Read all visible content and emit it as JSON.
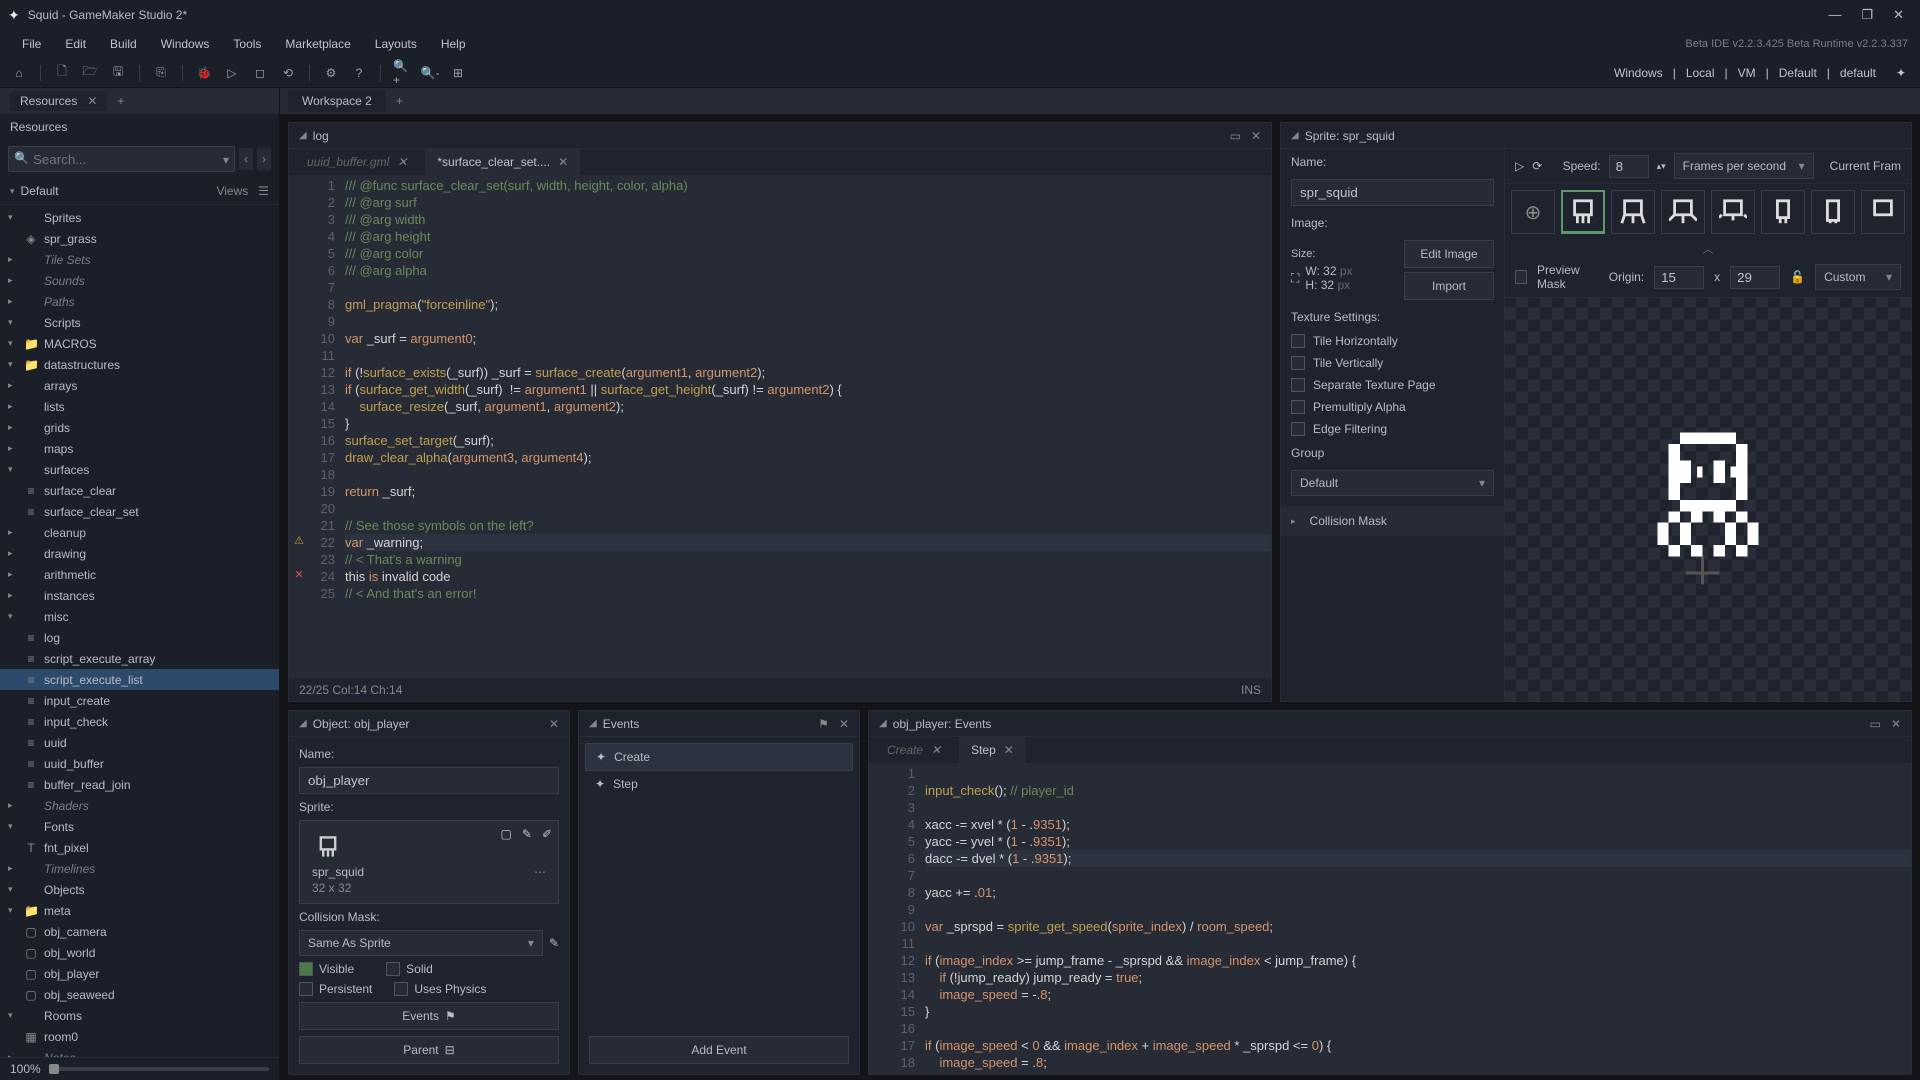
{
  "title": "Squid - GameMaker Studio 2*",
  "menu": [
    "File",
    "Edit",
    "Build",
    "Windows",
    "Tools",
    "Marketplace",
    "Layouts",
    "Help"
  ],
  "version": "Beta IDE v2.2.3.425 Beta Runtime v2.2.3.337",
  "targets": [
    "Windows",
    "Local",
    "VM",
    "Default",
    "default"
  ],
  "sidebar": {
    "tab": "Resources",
    "header": "Resources",
    "search_ph": "Search...",
    "default": "Default",
    "views": "Views",
    "zoom": "100%"
  },
  "tree": [
    {
      "d": 0,
      "exp": "▾",
      "ic": "",
      "lbl": "Sprites"
    },
    {
      "d": 1,
      "exp": "",
      "ic": "◈",
      "lbl": "spr_grass"
    },
    {
      "d": 0,
      "exp": "▸",
      "ic": "",
      "lbl": "Tile Sets",
      "it": true
    },
    {
      "d": 0,
      "exp": "▸",
      "ic": "",
      "lbl": "Sounds",
      "it": true
    },
    {
      "d": 0,
      "exp": "▸",
      "ic": "",
      "lbl": "Paths",
      "it": true
    },
    {
      "d": 0,
      "exp": "▾",
      "ic": "",
      "lbl": "Scripts"
    },
    {
      "d": 1,
      "exp": "▾",
      "ic": "📁",
      "lbl": "MACROS"
    },
    {
      "d": 1,
      "exp": "▾",
      "ic": "📁",
      "lbl": "datastructures"
    },
    {
      "d": 2,
      "exp": "▸",
      "ic": "",
      "lbl": "arrays"
    },
    {
      "d": 2,
      "exp": "▸",
      "ic": "",
      "lbl": "lists"
    },
    {
      "d": 2,
      "exp": "▸",
      "ic": "",
      "lbl": "grids"
    },
    {
      "d": 2,
      "exp": "▸",
      "ic": "",
      "lbl": "maps"
    },
    {
      "d": 2,
      "exp": "▾",
      "ic": "",
      "lbl": "surfaces"
    },
    {
      "d": 3,
      "exp": "",
      "ic": "≡",
      "lbl": "surface_clear"
    },
    {
      "d": 3,
      "exp": "",
      "ic": "≡",
      "lbl": "surface_clear_set"
    },
    {
      "d": 2,
      "exp": "▸",
      "ic": "",
      "lbl": "cleanup"
    },
    {
      "d": 1,
      "exp": "▸",
      "ic": "",
      "lbl": "drawing"
    },
    {
      "d": 1,
      "exp": "▸",
      "ic": "",
      "lbl": "arithmetic"
    },
    {
      "d": 1,
      "exp": "▸",
      "ic": "",
      "lbl": "instances"
    },
    {
      "d": 1,
      "exp": "▾",
      "ic": "",
      "lbl": "misc"
    },
    {
      "d": 2,
      "exp": "",
      "ic": "≡",
      "lbl": "log"
    },
    {
      "d": 2,
      "exp": "",
      "ic": "≡",
      "lbl": "script_execute_array"
    },
    {
      "d": 2,
      "exp": "",
      "ic": "≡",
      "lbl": "script_execute_list",
      "sel": true
    },
    {
      "d": 1,
      "exp": "",
      "ic": "≡",
      "lbl": "input_create"
    },
    {
      "d": 1,
      "exp": "",
      "ic": "≡",
      "lbl": "input_check"
    },
    {
      "d": 1,
      "exp": "",
      "ic": "≡",
      "lbl": "uuid"
    },
    {
      "d": 1,
      "exp": "",
      "ic": "≡",
      "lbl": "uuid_buffer"
    },
    {
      "d": 1,
      "exp": "",
      "ic": "≡",
      "lbl": "buffer_read_join"
    },
    {
      "d": 0,
      "exp": "▸",
      "ic": "",
      "lbl": "Shaders",
      "it": true
    },
    {
      "d": 0,
      "exp": "▾",
      "ic": "",
      "lbl": "Fonts"
    },
    {
      "d": 1,
      "exp": "",
      "ic": "T",
      "lbl": "fnt_pixel"
    },
    {
      "d": 0,
      "exp": "▸",
      "ic": "",
      "lbl": "Timelines",
      "it": true
    },
    {
      "d": 0,
      "exp": "▾",
      "ic": "",
      "lbl": "Objects"
    },
    {
      "d": 1,
      "exp": "▾",
      "ic": "📁",
      "lbl": "meta"
    },
    {
      "d": 2,
      "exp": "",
      "ic": "▢",
      "lbl": "obj_camera"
    },
    {
      "d": 2,
      "exp": "",
      "ic": "▢",
      "lbl": "obj_world"
    },
    {
      "d": 1,
      "exp": "",
      "ic": "▢",
      "lbl": "obj_player"
    },
    {
      "d": 1,
      "exp": "",
      "ic": "▢",
      "lbl": "obj_seaweed"
    },
    {
      "d": 0,
      "exp": "▾",
      "ic": "",
      "lbl": "Rooms"
    },
    {
      "d": 1,
      "exp": "",
      "ic": "▦",
      "lbl": "room0"
    },
    {
      "d": 0,
      "exp": "▸",
      "ic": "",
      "lbl": "Notes",
      "it": true
    }
  ],
  "workspace_tab": "Workspace 2",
  "log": {
    "title": "log",
    "tabs": [
      {
        "n": "uuid_buffer.gml",
        "act": false
      },
      {
        "n": "*surface_clear_set....",
        "act": true
      }
    ],
    "status": "22/25 Col:14 Ch:14",
    "mode": "INS"
  },
  "code": [
    {
      "n": 1,
      "h": "<span class='c-cmt'>/// @func surface_clear_set(surf, width, height, color, alpha)</span>"
    },
    {
      "n": 2,
      "h": "<span class='c-cmt'>/// @arg surf</span>"
    },
    {
      "n": 3,
      "h": "<span class='c-cmt'>/// @arg width</span>"
    },
    {
      "n": 4,
      "h": "<span class='c-cmt'>/// @arg height</span>"
    },
    {
      "n": 5,
      "h": "<span class='c-cmt'>/// @arg color</span>"
    },
    {
      "n": 6,
      "h": "<span class='c-cmt'>/// @arg alpha</span>"
    },
    {
      "n": 7,
      "h": ""
    },
    {
      "n": 8,
      "h": "<span class='c-fn'>gml_pragma</span><span class='c-pln'>(</span><span class='c-str'>\"forceinline\"</span><span class='c-pln'>);</span>"
    },
    {
      "n": 9,
      "h": ""
    },
    {
      "n": 10,
      "h": "<span class='c-key'>var</span> <span class='c-pln'>_surf = </span><span class='c-var'>argument0</span><span class='c-pln'>;</span>"
    },
    {
      "n": 11,
      "h": ""
    },
    {
      "n": 12,
      "h": "<span class='c-key'>if</span> <span class='c-pln'>(!</span><span class='c-fn'>surface_exists</span><span class='c-pln'>(_surf)) _surf = </span><span class='c-fn'>surface_create</span><span class='c-pln'>(</span><span class='c-var'>argument1</span><span class='c-pln'>, </span><span class='c-var'>argument2</span><span class='c-pln'>);</span>"
    },
    {
      "n": 13,
      "h": "<span class='c-key'>if</span> <span class='c-pln'>(</span><span class='c-fn'>surface_get_width</span><span class='c-pln'>(_surf)  != </span><span class='c-var'>argument1</span><span class='c-pln'> || </span><span class='c-fn'>surface_get_height</span><span class='c-pln'>(_surf) != </span><span class='c-var'>argument2</span><span class='c-pln'>) {</span>"
    },
    {
      "n": 14,
      "h": "    <span class='c-fn'>surface_resize</span><span class='c-pln'>(_surf, </span><span class='c-var'>argument1</span><span class='c-pln'>, </span><span class='c-var'>argument2</span><span class='c-pln'>);</span>"
    },
    {
      "n": 15,
      "h": "<span class='c-pln'>}</span>"
    },
    {
      "n": 16,
      "h": "<span class='c-fn'>surface_set_target</span><span class='c-pln'>(_surf);</span>"
    },
    {
      "n": 17,
      "h": "<span class='c-fn'>draw_clear_alpha</span><span class='c-pln'>(</span><span class='c-var'>argument3</span><span class='c-pln'>, </span><span class='c-var'>argument4</span><span class='c-pln'>);</span>"
    },
    {
      "n": 18,
      "h": ""
    },
    {
      "n": 19,
      "h": "<span class='c-key'>return</span> <span class='c-pln'>_surf;</span>"
    },
    {
      "n": 20,
      "h": ""
    },
    {
      "n": 21,
      "h": "<span class='c-cmt'>// See those symbols on the left?</span>"
    },
    {
      "n": 22,
      "m": "⚠",
      "mc": "#c0a030",
      "hl": true,
      "h": "<span class='c-key'>var</span> <span class='c-pln'>_warning;</span>"
    },
    {
      "n": 23,
      "h": "<span class='c-cmt'>// &lt; That's a warning</span>"
    },
    {
      "n": 24,
      "m": "✕",
      "mc": "#e05050",
      "h": "<span class='c-pln'>this </span><span class='c-key'>is</span><span class='c-pln'> invalid code</span>"
    },
    {
      "n": 25,
      "h": "<span class='c-cmt'>// &lt; And that's an error!</span>"
    }
  ],
  "obj": {
    "title": "Object: obj_player",
    "name_lbl": "Name:",
    "name": "obj_player",
    "sprite_lbl": "Sprite:",
    "sprite": "spr_squid",
    "size": "32 x 32",
    "cm_lbl": "Collision Mask:",
    "cm": "Same As Sprite",
    "visible": "Visible",
    "solid": "Solid",
    "persistent": "Persistent",
    "physics": "Uses Physics",
    "events_btn": "Events",
    "parent_btn": "Parent"
  },
  "evp": {
    "title": "Events",
    "create": "Create",
    "step": "Step",
    "add": "Add Event"
  },
  "ep": {
    "title": "obj_player: Events",
    "tabs": [
      {
        "n": "Create",
        "act": false
      },
      {
        "n": "Step",
        "act": true
      }
    ]
  },
  "epcode": [
    {
      "n": 1,
      "h": ""
    },
    {
      "n": 2,
      "h": "<span class='c-fn'>input_check</span><span class='c-pln'>();</span> <span class='c-cmt'>// player_id</span>"
    },
    {
      "n": 3,
      "h": ""
    },
    {
      "n": 4,
      "h": "<span class='c-pln'>xacc -= xvel * (</span><span class='c-num'>1</span><span class='c-pln'> - .</span><span class='c-num'>9351</span><span class='c-pln'>);</span>"
    },
    {
      "n": 5,
      "h": "<span class='c-pln'>yacc -= yvel * (</span><span class='c-num'>1</span><span class='c-pln'> - .</span><span class='c-num'>9351</span><span class='c-pln'>);</span>"
    },
    {
      "n": 6,
      "hl": true,
      "h": "<span class='c-pln'>dacc -= dvel * (</span><span class='c-num'>1</span><span class='c-pln'> - .</span><span class='c-num'>9351</span><span class='c-pln'>);</span>"
    },
    {
      "n": 7,
      "h": ""
    },
    {
      "n": 8,
      "h": "<span class='c-pln'>yacc += .</span><span class='c-num'>01</span><span class='c-pln'>;</span>"
    },
    {
      "n": 9,
      "h": ""
    },
    {
      "n": 10,
      "h": "<span class='c-key'>var</span> <span class='c-pln'>_sprspd = </span><span class='c-fn'>sprite_get_speed</span><span class='c-pln'>(</span><span class='c-var'>sprite_index</span><span class='c-pln'>) / </span><span class='c-var'>room_speed</span><span class='c-pln'>;</span>"
    },
    {
      "n": 11,
      "h": ""
    },
    {
      "n": 12,
      "h": "<span class='c-key'>if</span> <span class='c-pln'>(</span><span class='c-var'>image_index</span><span class='c-pln'> &gt;= jump_frame - _sprspd &amp;&amp; </span><span class='c-var'>image_index</span><span class='c-pln'> &lt; jump_frame) {</span>"
    },
    {
      "n": 13,
      "h": "    <span class='c-key'>if</span> <span class='c-pln'>(!jump_ready) jump_ready = </span><span class='c-key'>true</span><span class='c-pln'>;</span>"
    },
    {
      "n": 14,
      "h": "    <span class='c-var'>image_speed</span><span class='c-pln'> = -.</span><span class='c-num'>8</span><span class='c-pln'>;</span>"
    },
    {
      "n": 15,
      "h": "<span class='c-pln'>}</span>"
    },
    {
      "n": 16,
      "h": ""
    },
    {
      "n": 17,
      "h": "<span class='c-key'>if</span> <span class='c-pln'>(</span><span class='c-var'>image_speed</span><span class='c-pln'> &lt; </span><span class='c-num'>0</span><span class='c-pln'> &amp;&amp; </span><span class='c-var'>image_index</span><span class='c-pln'> + </span><span class='c-var'>image_speed</span><span class='c-pln'> * _sprspd &lt;= </span><span class='c-num'>0</span><span class='c-pln'>) {</span>"
    },
    {
      "n": 18,
      "h": "    <span class='c-var'>image_speed</span><span class='c-pln'> = .</span><span class='c-num'>8</span><span class='c-pln'>;</span>"
    }
  ],
  "sprite": {
    "title": "Sprite: spr_squid",
    "name_lbl": "Name:",
    "name": "spr_squid",
    "speed_lbl": "Speed:",
    "speed": "8",
    "fps": "Frames per second",
    "cf": "Current Fram",
    "img_lbl": "Image:",
    "size_lbl": "Size:",
    "w": "W: 32",
    "h": "H: 32",
    "px": "px",
    "edit": "Edit Image",
    "import": "Import",
    "tex_lbl": "Texture Settings:",
    "tileh": "Tile Horizontally",
    "tilev": "Tile Vertically",
    "sep": "Separate Texture Page",
    "prem": "Premultiply Alpha",
    "edge": "Edge Filtering",
    "grp_lbl": "Group",
    "grp": "Default",
    "cm": "Collision Mask",
    "pm": "Preview Mask",
    "origin": "Origin:",
    "ox": "15",
    "oy": "29",
    "custom": "Custom",
    "x": "x"
  }
}
